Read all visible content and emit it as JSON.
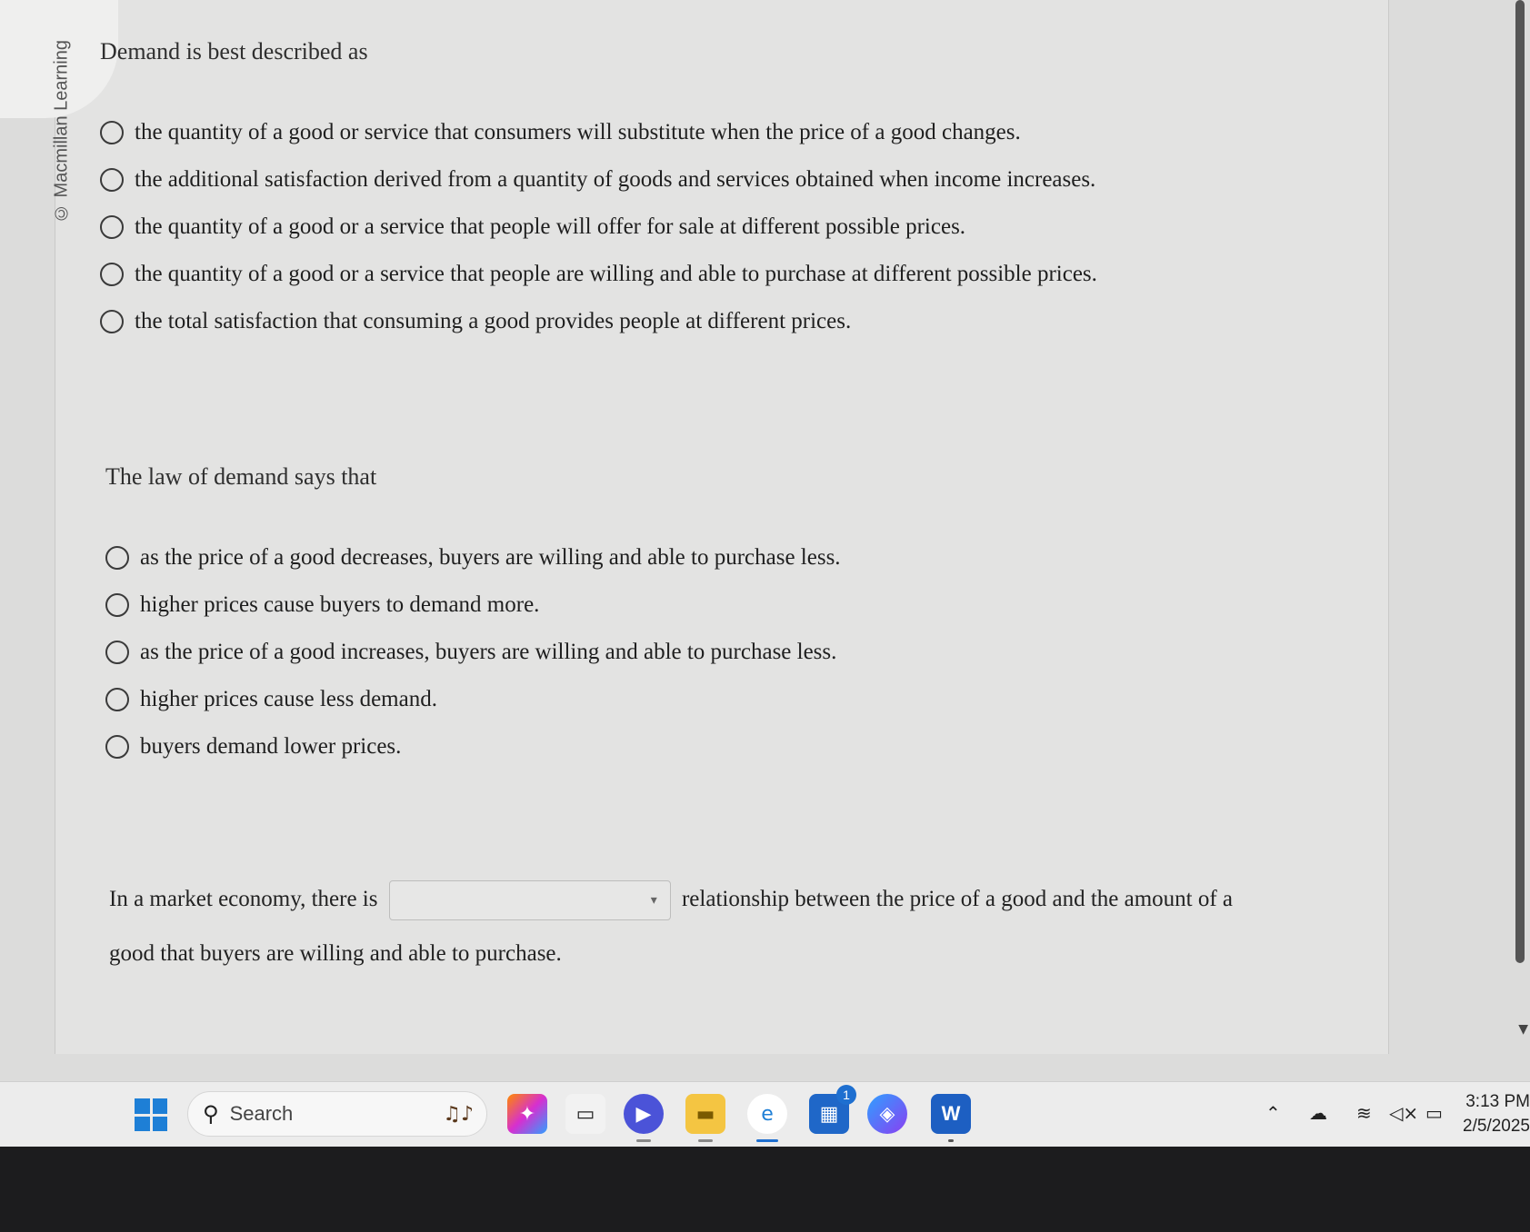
{
  "watermark": "© Macmillan Learning",
  "questions": [
    {
      "prompt": "Demand is best described as",
      "options": [
        "the quantity of a good or service that consumers will substitute when the price of a good changes.",
        "the additional satisfaction derived from a quantity of goods and services obtained when income increases.",
        "the quantity of a good or a service that people will offer for sale at different possible prices.",
        "the quantity of a good or a service that people are willing and able to purchase at different possible prices.",
        "the total satisfaction that consuming a good provides people at different prices."
      ]
    },
    {
      "prompt": "The  law of demand says that",
      "options": [
        "as the price of a good decreases, buyers are willing and able to purchase less.",
        "higher prices cause buyers to demand more.",
        "as the price of a good increases, buyers are willing and able to purchase less.",
        "higher prices cause less demand.",
        "buyers demand lower prices."
      ]
    }
  ],
  "fill_in": {
    "before": "In a market economy, there is",
    "dropdown_value": "",
    "after": "relationship between the price of a good and the amount of a",
    "continuation": "good that buyers are willing and able to purchase."
  },
  "taskbar": {
    "search_label": "Search",
    "apps": [
      "copilot-app",
      "file-app",
      "chat-app",
      "file-explorer",
      "edge-browser",
      "microsoft-store",
      "copilot-365",
      "word"
    ],
    "store_badge": "1",
    "clock_time": "3:13 PM",
    "clock_date": "2/5/2025"
  },
  "colors": {
    "radio_border": "#3a3a3a",
    "page_bg": "#e3e3e2",
    "windows_blue": "#1e7fd6"
  }
}
